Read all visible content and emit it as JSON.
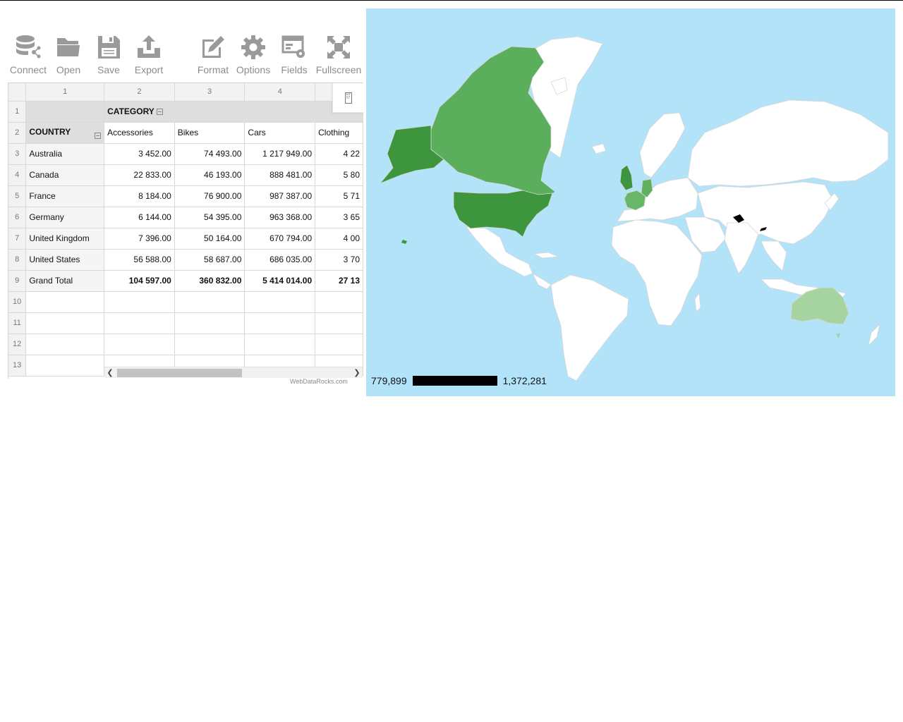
{
  "toolbar": {
    "buttons": [
      {
        "label": "Connect",
        "icon": "database-icon"
      },
      {
        "label": "Open",
        "icon": "folder-icon"
      },
      {
        "label": "Save",
        "icon": "floppy-icon"
      },
      {
        "label": "Export",
        "icon": "export-icon"
      },
      {
        "label": "Format",
        "icon": "pencil-icon"
      },
      {
        "label": "Options",
        "icon": "gear-icon"
      },
      {
        "label": "Fields",
        "icon": "fields-icon"
      },
      {
        "label": "Fullscreen",
        "icon": "fullscreen-icon"
      }
    ]
  },
  "grid": {
    "column_numbers": [
      "1",
      "2",
      "3",
      "4"
    ],
    "row_numbers": [
      "1",
      "2",
      "3",
      "4",
      "5",
      "6",
      "7",
      "8",
      "9",
      "10",
      "11",
      "12",
      "13"
    ],
    "column_field": "CATEGORY",
    "row_field": "COUNTRY",
    "categories": [
      "Accessories",
      "Bikes",
      "Cars",
      "Clothing"
    ],
    "rows": [
      {
        "country": "Australia",
        "values": [
          "3 452.00",
          "74 493.00",
          "1 217 949.00",
          "4 22"
        ]
      },
      {
        "country": "Canada",
        "values": [
          "22 833.00",
          "46 193.00",
          "888 481.00",
          "5 80"
        ]
      },
      {
        "country": "France",
        "values": [
          "8 184.00",
          "76 900.00",
          "987 387.00",
          "5 71"
        ]
      },
      {
        "country": "Germany",
        "values": [
          "6 144.00",
          "54 395.00",
          "963 368.00",
          "3 65"
        ]
      },
      {
        "country": "United Kingdom",
        "values": [
          "7 396.00",
          "50 164.00",
          "670 794.00",
          "4 00"
        ]
      },
      {
        "country": "United States",
        "values": [
          "56 588.00",
          "58 687.00",
          "686 035.00",
          "3 70"
        ]
      }
    ],
    "total": {
      "label": "Grand Total",
      "values": [
        "104 597.00",
        "360 832.00",
        "5 414 014.00",
        "27 13"
      ]
    },
    "credit": "WebDataRocks.com"
  },
  "map": {
    "legend_min": "779,899",
    "legend_max": "1,372,281",
    "colors": {
      "water": "#b3e3f9",
      "land": "#ffffff",
      "border": "#d6d6d6",
      "usa": "#3d963d",
      "canada": "#5bae5b",
      "uk": "#3d963d",
      "france": "#68b768",
      "germany": "#5fb05f",
      "australia": "#a6d4a0",
      "no_data": "#000000"
    }
  }
}
